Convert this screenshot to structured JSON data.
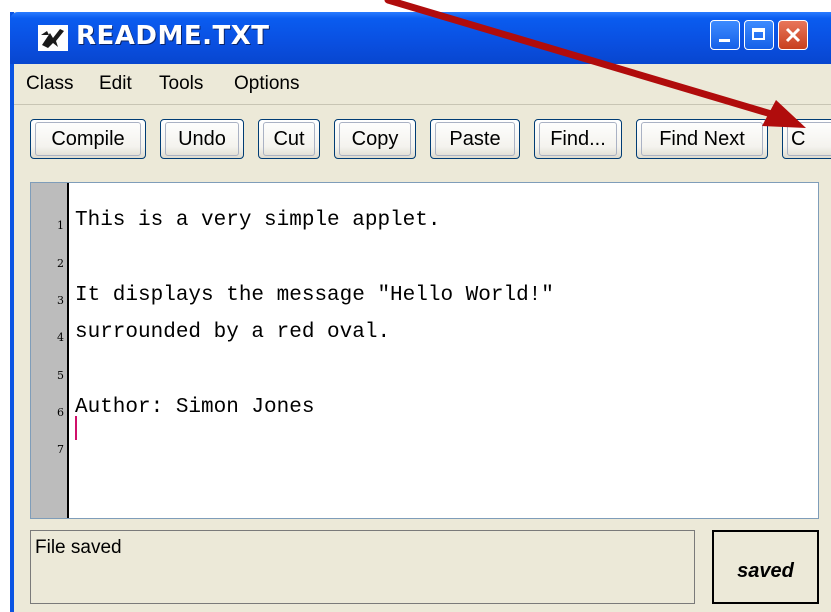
{
  "window": {
    "title": "README.TXT",
    "controls": [
      "minimize-icon",
      "maximize-icon",
      "close-icon"
    ]
  },
  "menu": [
    "Class",
    "Edit",
    "Tools",
    "Options"
  ],
  "toolbar": {
    "buttons": [
      "Compile",
      "Undo",
      "Cut",
      "Copy",
      "Paste",
      "Find...",
      "Find Next",
      "C"
    ]
  },
  "editor": {
    "lines": [
      {
        "number": "1",
        "text": "This is a very simple applet."
      },
      {
        "number": "2",
        "text": ""
      },
      {
        "number": "3",
        "text": "It displays the message \"Hello World!\""
      },
      {
        "number": "4",
        "text": "surrounded by a red oval."
      },
      {
        "number": "5",
        "text": ""
      },
      {
        "number": "6",
        "text": "Author: Simon Jones"
      },
      {
        "number": "7",
        "text": ""
      }
    ]
  },
  "status": {
    "message": "File saved",
    "state": "saved"
  },
  "colors": {
    "titlebar": "#0a4fe0",
    "annotation_arrow": "#b00c0c",
    "caret": "#d0106a"
  }
}
